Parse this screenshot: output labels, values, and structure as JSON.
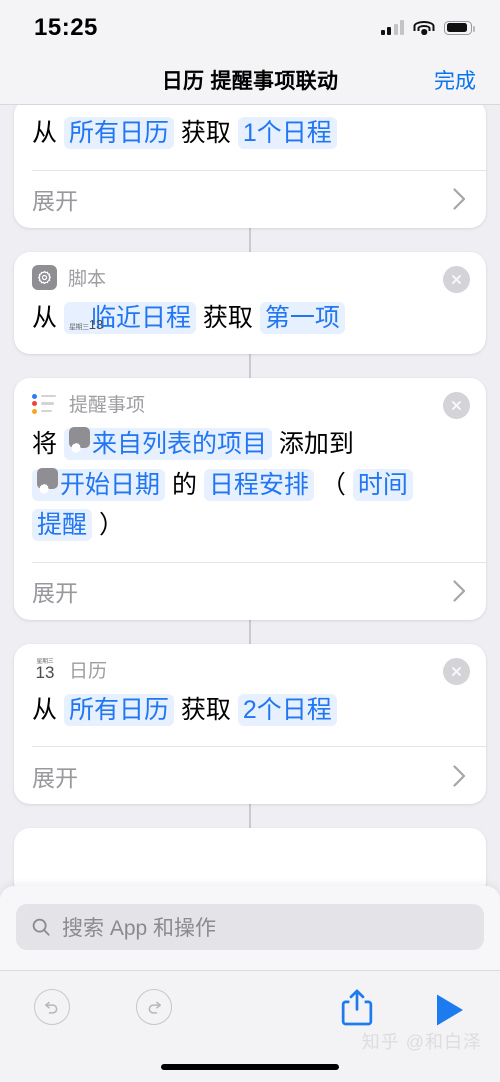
{
  "status_bar": {
    "time": "15:25",
    "signal_icon": "cellular-signal-icon",
    "wifi_icon": "wifi-icon",
    "battery_icon": "battery-icon"
  },
  "nav": {
    "title": "日历 提醒事项联动",
    "done_label": "完成"
  },
  "colors": {
    "accent_blue": "#0a74ef",
    "token_text": "#2176f3",
    "token_bg": "#e6f0fe",
    "page_bg": "#efeff3",
    "card_bg": "#ffffff",
    "muted_text": "#98989d"
  },
  "expand_label": "展开",
  "actions": [
    {
      "id": "calendar-find-1",
      "app_label": "",
      "icon": "",
      "has_header": false,
      "has_close": false,
      "segments": [
        {
          "text": "从 ",
          "type": "plain"
        },
        {
          "text": "所有日历",
          "type": "token"
        },
        {
          "text": " 获取 ",
          "type": "plain"
        },
        {
          "text": "1个日程",
          "type": "token"
        }
      ],
      "expandable": true
    },
    {
      "id": "scripting-get-item",
      "app_label": "脚本",
      "icon": "script-gear-icon",
      "has_header": true,
      "has_close": true,
      "segments": [
        {
          "text": "从 ",
          "type": "plain"
        },
        {
          "text": "临近日程",
          "type": "token",
          "inline_icon": "calendar-icon"
        },
        {
          "text": " 获取 ",
          "type": "plain"
        },
        {
          "text": "第一项",
          "type": "token"
        }
      ],
      "expandable": false
    },
    {
      "id": "reminders-add-item",
      "app_label": "提醒事项",
      "icon": "reminders-list-icon",
      "has_header": true,
      "has_close": true,
      "segments": [
        {
          "text": "将 ",
          "type": "plain"
        },
        {
          "text": "来自列表的项目",
          "type": "token",
          "inline_icon": "gear-icon"
        },
        {
          "text": " 添加到 ",
          "type": "plain"
        },
        {
          "text": "开始日期",
          "type": "token",
          "inline_icon": "gear-icon"
        },
        {
          "text": " 的 ",
          "type": "plain"
        },
        {
          "text": "日程安排",
          "type": "token"
        },
        {
          "text": " （ ",
          "type": "plain"
        },
        {
          "text": "时间",
          "type": "token"
        },
        {
          "text": " ",
          "type": "plain"
        },
        {
          "text": "提醒",
          "type": "token"
        },
        {
          "text": " ）",
          "type": "plain"
        }
      ],
      "expandable": true
    },
    {
      "id": "calendar-find-2",
      "app_label": "日历",
      "icon": "calendar-icon",
      "has_header": true,
      "has_close": true,
      "segments": [
        {
          "text": "从 ",
          "type": "plain"
        },
        {
          "text": "所有日历",
          "type": "token"
        },
        {
          "text": " 获取 ",
          "type": "plain"
        },
        {
          "text": "2个日程",
          "type": "token"
        }
      ],
      "expandable": true
    }
  ],
  "calendar_icon": {
    "weekday": "星期三",
    "day": "13"
  },
  "search": {
    "placeholder": "搜索 App 和操作",
    "value": "",
    "icon": "search-icon"
  },
  "toolbar": {
    "undo": "undo-icon",
    "redo": "redo-icon",
    "share": "share-icon",
    "run": "play-icon"
  },
  "watermark": "知乎 @和白泽"
}
